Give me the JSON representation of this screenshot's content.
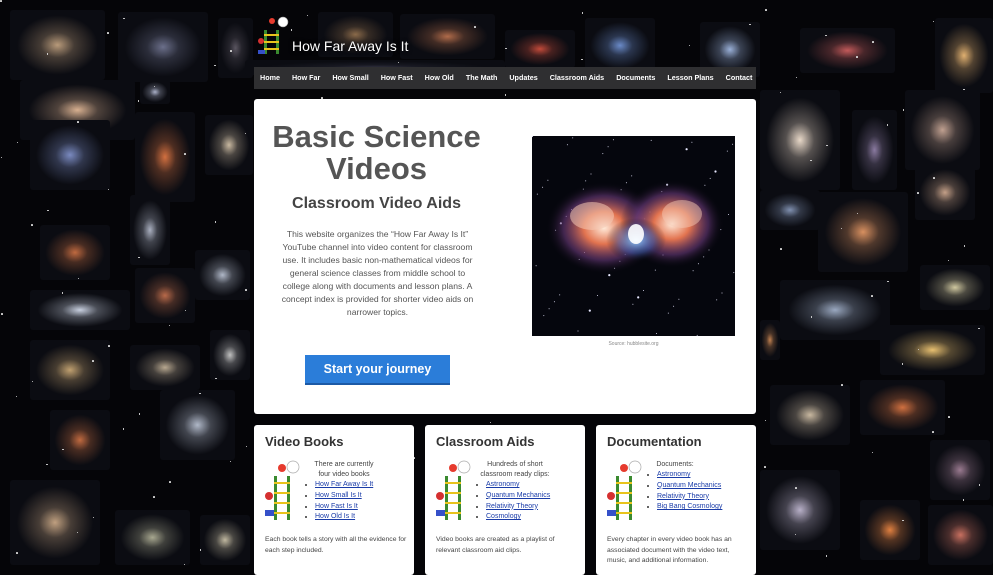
{
  "site": {
    "title": "How Far Away Is It"
  },
  "nav": [
    "Home",
    "How Far",
    "How Small",
    "How Fast",
    "How Old",
    "The Math",
    "Updates",
    "Classroom Aids",
    "Documents",
    "Lesson Plans",
    "Contact"
  ],
  "hero": {
    "title": "Basic Science Videos",
    "subtitle": "Classroom Video Aids",
    "body": "This website organizes the “How Far Away Is It” YouTube channel into video content for classroom use. It includes basic non-mathematical videos for general science classes from middle school to college along with documents and lesson plans. A concept index is provided for shorter video aids on narrower topics.",
    "cta": "Start your journey",
    "photo_credit": "Source: hubblesite.org"
  },
  "cards": [
    {
      "title": "Video Books",
      "intro": "There are currently four video books",
      "links": [
        "How Far Away Is It",
        "How Small Is It",
        "How Fast Is It",
        "How Old Is It"
      ],
      "footer": "Each book tells a story with all the evidence for each step included."
    },
    {
      "title": "Classroom Aids",
      "intro": "Hundreds of short classroom ready clips:",
      "links": [
        "Astronomy",
        "Quantum Mechanics",
        "Relativity Theory",
        "Cosmology"
      ],
      "footer": "Video books are created as a playlist of relevant classroom aid clips."
    },
    {
      "title": "Documentation",
      "intro": "Documents:",
      "links": [
        "Astronomy",
        "Quantum Mechanics",
        "Relativity Theory",
        "Big Bang Cosmology"
      ],
      "footer": "Every chapter in every video book has an associated document with the video text, music, and additional information."
    }
  ],
  "colors": {
    "accent": "#2b7dd9",
    "nav_bg": "#2f2f31",
    "link": "#1a3ca8",
    "background": "#050508"
  },
  "icons": {
    "logo": "robot-ladder-logo",
    "card_icon": "robot-ladder-icon"
  }
}
